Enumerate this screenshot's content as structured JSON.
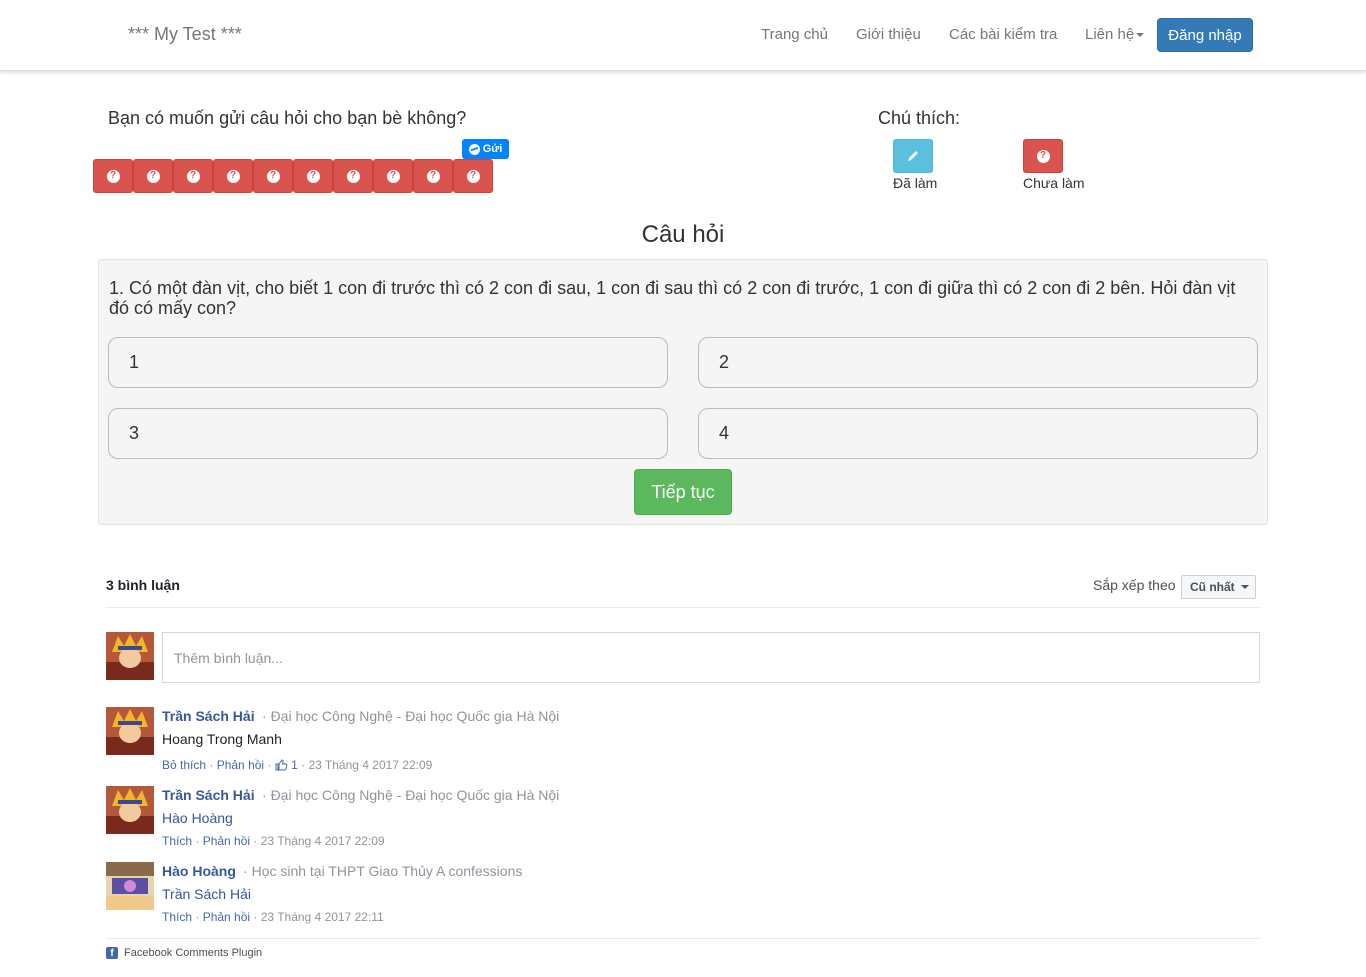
{
  "navbar": {
    "brand": "*** My Test ***",
    "links": [
      "Trang chủ",
      "Giới thiệu",
      "Các bài kiểm tra",
      "Liên hệ"
    ],
    "login_label": "Đăng nhập"
  },
  "share": {
    "prompt": "Bạn có muốn gửi câu hỏi cho bạn bè không?",
    "send_label": "Gửi",
    "question_button_count": 10
  },
  "legend": {
    "title": "Chú thích:",
    "done_label": "Đã làm",
    "todo_label": "Chưa làm"
  },
  "quiz": {
    "section_title": "Câu hỏi",
    "question": "1. Có một đàn vịt, cho biết 1 con đi trước thì có 2 con đi sau, 1 con đi sau thì có 2 con đi trước, 1 con đi giữa thì có 2 con đi 2 bên. Hỏi đàn vịt đó có mấy con?",
    "answers": [
      "1",
      "2",
      "3",
      "4"
    ],
    "next_label": "Tiếp tục"
  },
  "comments": {
    "count_label": "3 bình luận",
    "sort_label": "Sắp xếp theo",
    "sort_value": "Cũ nhất",
    "input_placeholder": "Thêm bình luận...",
    "items": [
      {
        "name": "Trần Sách Hải",
        "affiliation": "Đại học Công Nghệ - Đại học Quốc gia Hà Nội",
        "body": "Hoang Trong Manh",
        "action1": "Bỏ thích",
        "action2": "Phản hồi",
        "likes": "1",
        "time": "23 Tháng 4 2017 22:09"
      },
      {
        "name": "Trần Sách Hải",
        "affiliation": "Đại học Công Nghệ - Đại học Quốc gia Hà Nội",
        "body": "Hào Hoàng",
        "action1": "Thích",
        "action2": "Phản hồi",
        "time": "23 Tháng 4 2017 22:09"
      },
      {
        "name": "Hào Hoàng",
        "affiliation": "Học sinh tại THPT Giao Thủy A confessions",
        "body": "Trần Sách Hải",
        "action1": "Thích",
        "action2": "Phản hồi",
        "time": "23 Tháng 4 2017 22:11"
      }
    ],
    "footer": "Facebook Comments Plugin"
  },
  "colors": {
    "primary": "#337ab7",
    "danger": "#d9534f",
    "info": "#5bc0de",
    "success": "#5cb85c",
    "messenger": "#0084ff",
    "fb_link": "#365899"
  },
  "icons": {
    "question_buttons": "question-circle-icon",
    "done": "pencil-icon",
    "send": "messenger-icon",
    "like": "thumbs-up-icon",
    "footer": "facebook-icon"
  }
}
